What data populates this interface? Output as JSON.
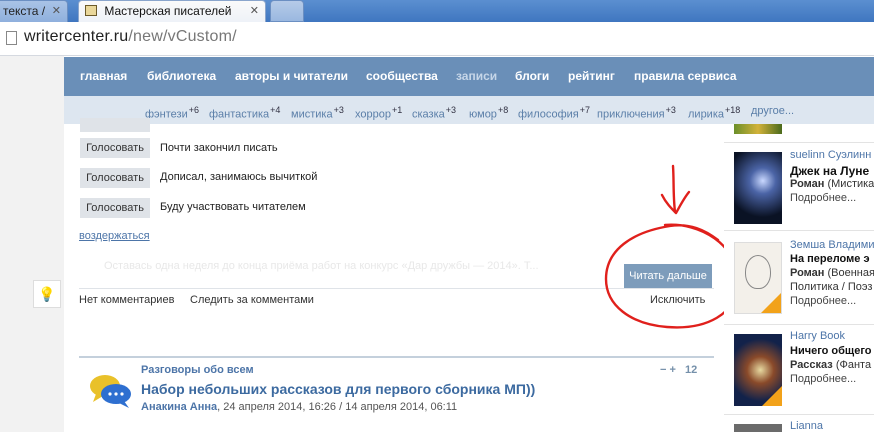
{
  "browser": {
    "tabs": [
      {
        "label": "текста /"
      },
      {
        "label": "Мастерская писателей"
      }
    ],
    "url": {
      "domain": "writercenter.ru",
      "path": "/new/vCustom/"
    }
  },
  "nav": {
    "main": [
      "главная",
      "библиотека",
      "авторы и читатели",
      "сообщества",
      "записи",
      "блоги",
      "рейтинг",
      "правила сервиса"
    ],
    "genres": [
      {
        "label": "фэнтези",
        "count": "+6"
      },
      {
        "label": "фантастика",
        "count": "+4"
      },
      {
        "label": "мистика",
        "count": "+3"
      },
      {
        "label": "хоррор",
        "count": "+1"
      },
      {
        "label": "сказка",
        "count": "+3"
      },
      {
        "label": "юмор",
        "count": "+8"
      },
      {
        "label": "философия",
        "count": "+7"
      },
      {
        "label": "приключения",
        "count": "+3"
      },
      {
        "label": "лирика",
        "count": "+18"
      },
      {
        "label": "другое...",
        "count": ""
      }
    ]
  },
  "poll": {
    "vote_label": "Голосовать",
    "options": [
      "Почти закончил писать",
      "Дописал, занимаюсь вычиткой",
      "Буду участвовать читателем"
    ],
    "abstain": "воздержаться"
  },
  "faded_text": "Оставась одна неделя до конца приёма работ на конкурс «Дар дружбы — 2014». Т...",
  "read_more": "Читать дальше",
  "footer": {
    "no_comments": "Нет комментариев",
    "follow": "Следить за комментами",
    "exclude": "Исключить"
  },
  "post": {
    "category": "Разговоры обо всем",
    "title": "Набор небольших рассказов для первого сборника МП))",
    "author": "Анакина Анна",
    "dates": ", 24 апреля 2014, 16:26 / 14 апреля 2014, 06:11",
    "rating": "12",
    "minus": "−",
    "plus": "+"
  },
  "sidebar": [
    {
      "author": "suelinn Суэлинн",
      "title1": "Джек на Луне",
      "title2": "Роман",
      "genre": "(Мистика",
      "more": "Подробнее..."
    },
    {
      "author": "Земша Владимир",
      "title1": "На переломе э",
      "title2": "Роман",
      "genre": "(Военная",
      "extra": "Политика / Поэз",
      "more": "Подробнее..."
    },
    {
      "author": "Harry Book",
      "title1": "Ничего общего",
      "title2": "Рассказ",
      "genre": "(Фанта",
      "more": "Подробнее..."
    },
    {
      "author": "Lianna"
    }
  ],
  "annotation": {
    "color": "#e0201c"
  }
}
